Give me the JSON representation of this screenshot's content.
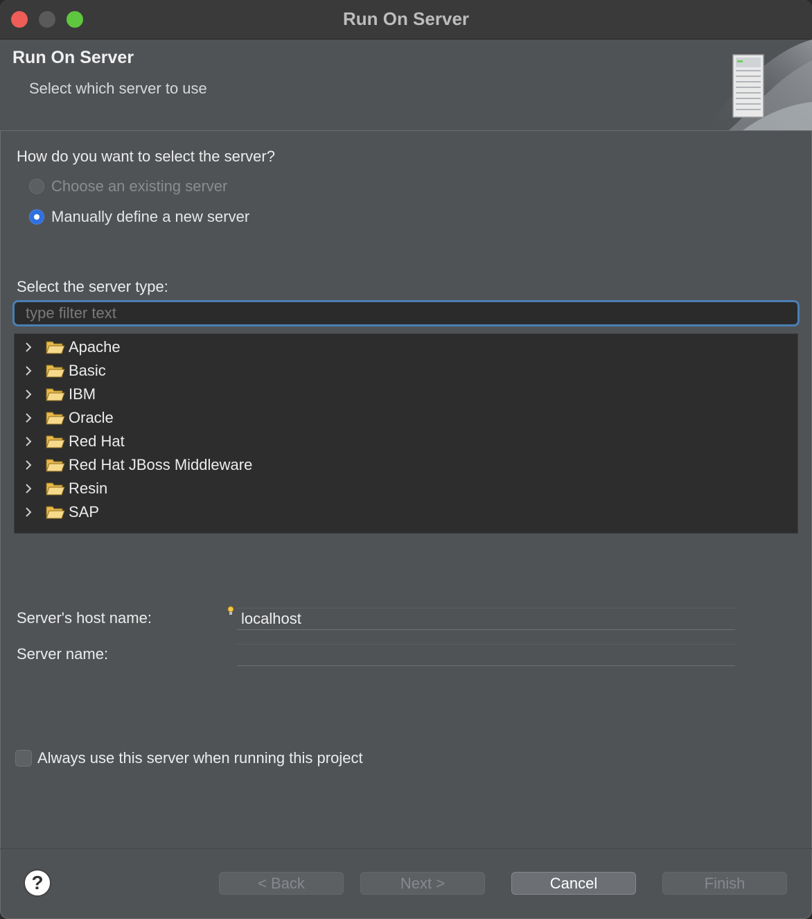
{
  "window": {
    "title": "Run On Server"
  },
  "banner": {
    "title": "Run On Server",
    "subtitle": "Select which server to use",
    "icon": "server-icon"
  },
  "selection": {
    "question": "How do you want to select the server?",
    "options": [
      {
        "label": "Choose an existing server",
        "selected": false,
        "enabled": false
      },
      {
        "label": "Manually define a new server",
        "selected": true,
        "enabled": true
      }
    ]
  },
  "server_type": {
    "label": "Select the server type:",
    "filter_placeholder": "type filter text",
    "tree": [
      {
        "label": "Apache"
      },
      {
        "label": "Basic"
      },
      {
        "label": "IBM"
      },
      {
        "label": "Oracle"
      },
      {
        "label": "Red Hat"
      },
      {
        "label": "Red Hat JBoss Middleware"
      },
      {
        "label": "Resin"
      },
      {
        "label": "SAP"
      }
    ]
  },
  "fields": {
    "host_label": "Server's host name:",
    "host_value": "localhost",
    "name_label": "Server name:",
    "name_value": ""
  },
  "always_use": {
    "label": "Always use this server when running this project",
    "checked": false
  },
  "buttons": {
    "help": "?",
    "back": "< Back",
    "next": "Next >",
    "cancel": "Cancel",
    "finish": "Finish"
  },
  "colors": {
    "accent": "#2f6fe0",
    "focus_ring": "#4a7fb5",
    "close_light": "#ee5d57",
    "max_light": "#5fc63f"
  }
}
